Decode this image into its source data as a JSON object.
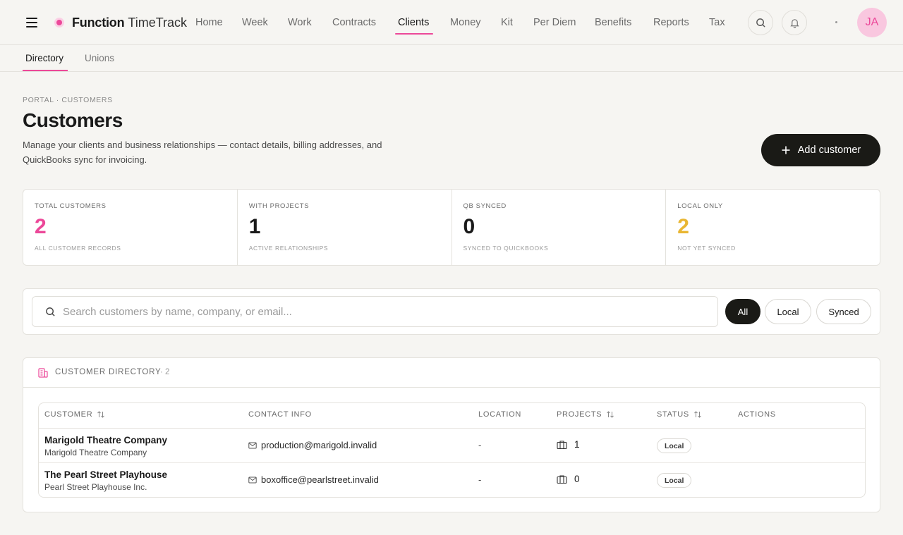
{
  "app": {
    "brand_bold": "Function",
    "brand_light": "TimeTrack"
  },
  "nav": {
    "items": [
      {
        "label": "Home"
      },
      {
        "label": "Week"
      },
      {
        "label": "Work"
      },
      {
        "label": "Contracts"
      },
      {
        "label": "Clients"
      },
      {
        "label": "Money"
      },
      {
        "label": "Kit"
      },
      {
        "label": "Per Diem"
      },
      {
        "label": "Benefits"
      },
      {
        "label": "Reports"
      },
      {
        "label": "Tax"
      }
    ],
    "active": "Clients",
    "avatar_initials": "JA"
  },
  "subnav": {
    "items": [
      {
        "label": "Directory"
      },
      {
        "label": "Unions"
      }
    ],
    "active": "Directory"
  },
  "header": {
    "breadcrumb": "PORTAL · CUSTOMERS",
    "title": "Customers",
    "description": "Manage your clients and business relationships — contact details, billing addresses, and QuickBooks sync for invoicing.",
    "add_button": "Add customer"
  },
  "stats": [
    {
      "label": "TOTAL CUSTOMERS",
      "value": "2",
      "sub": "ALL CUSTOMER RECORDS",
      "color": "#ec4899"
    },
    {
      "label": "WITH PROJECTS",
      "value": "1",
      "sub": "ACTIVE RELATIONSHIPS",
      "color": "#1a1a1a"
    },
    {
      "label": "QB SYNCED",
      "value": "0",
      "sub": "SYNCED TO QUICKBOOKS",
      "color": "#1a1a1a"
    },
    {
      "label": "LOCAL ONLY",
      "value": "2",
      "sub": "NOT YET SYNCED",
      "color": "#e9b632"
    }
  ],
  "search": {
    "placeholder": "Search customers by name, company, or email...",
    "value": "",
    "filters": [
      {
        "label": "All"
      },
      {
        "label": "Local"
      },
      {
        "label": "Synced"
      }
    ],
    "active_filter": "All"
  },
  "directory": {
    "title": "CUSTOMER DIRECTORY",
    "count": "· 2",
    "columns": {
      "customer": "CUSTOMER",
      "contact": "CONTACT INFO",
      "location": "LOCATION",
      "projects": "PROJECTS",
      "status": "STATUS",
      "actions": "ACTIONS"
    },
    "rows": [
      {
        "name": "Marigold Theatre Company",
        "company": "Marigold Theatre Company",
        "email": "production@marigold.invalid",
        "location": "-",
        "projects": "1",
        "status": "Local"
      },
      {
        "name": "The Pearl Street Playhouse",
        "company": "Pearl Street Playhouse Inc.",
        "email": "boxoffice@pearlstreet.invalid",
        "location": "-",
        "projects": "0",
        "status": "Local"
      }
    ]
  },
  "colors": {
    "accent": "#ec4899",
    "dark": "#1a1a16",
    "gold": "#e9b632",
    "background": "#f6f5f2"
  },
  "icons": [
    "menu-icon",
    "search-icon",
    "bell-icon",
    "building-icon",
    "sort-icon",
    "mail-icon",
    "briefcase-icon",
    "plus-icon"
  ]
}
